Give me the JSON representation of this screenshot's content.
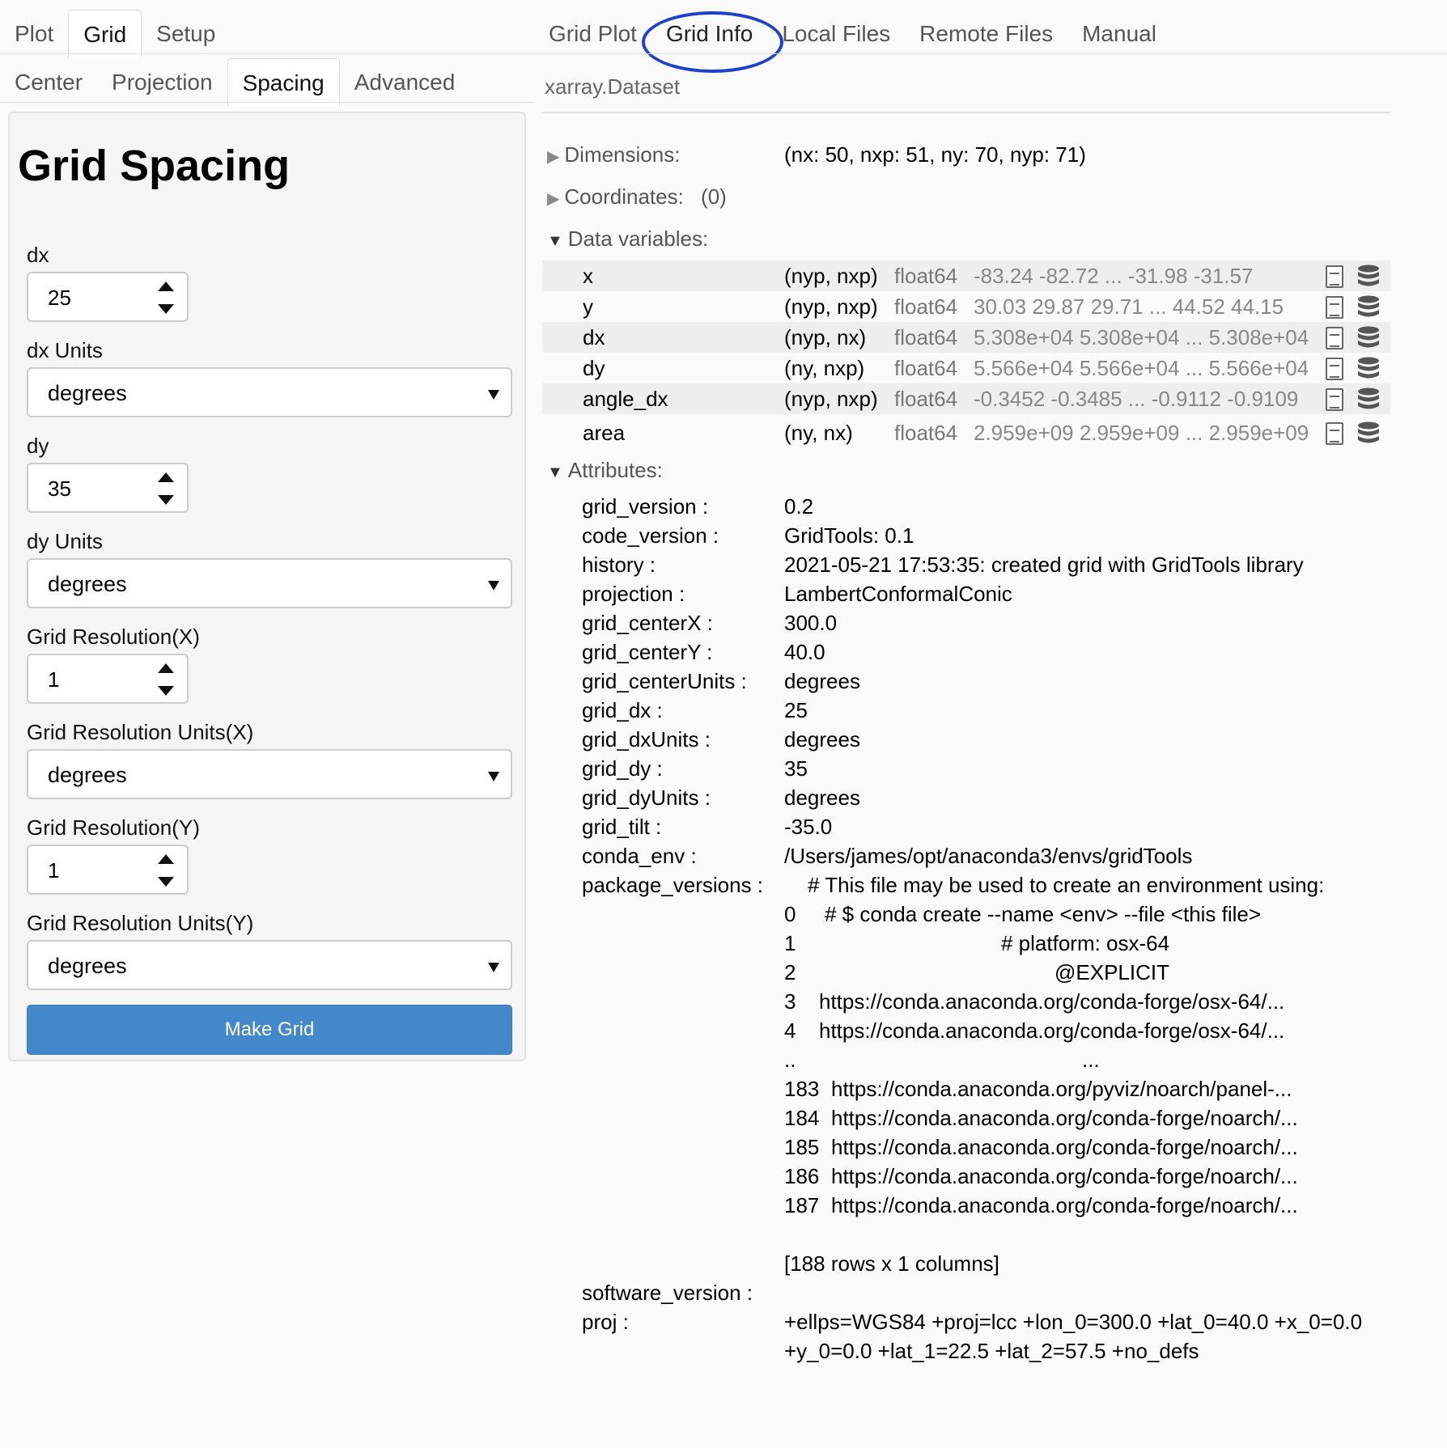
{
  "left_tabs": [
    "Plot",
    "Grid",
    "Setup"
  ],
  "left_active_tab": "Grid",
  "sub_tabs": [
    "Center",
    "Projection",
    "Spacing",
    "Advanced"
  ],
  "sub_active_tab": "Spacing",
  "right_tabs": [
    "Grid Plot",
    "Grid Info",
    "Local Files",
    "Remote Files",
    "Manual"
  ],
  "right_active_tab": "Grid Info",
  "panel": {
    "title": "Grid Spacing",
    "dx_label": "dx",
    "dx_value": "25",
    "dx_units_label": "dx Units",
    "dx_units_value": "degrees",
    "dy_label": "dy",
    "dy_value": "35",
    "dy_units_label": "dy Units",
    "dy_units_value": "degrees",
    "resx_label": "Grid Resolution(X)",
    "resx_value": "1",
    "resx_units_label": "Grid Resolution Units(X)",
    "resx_units_value": "degrees",
    "resy_label": "Grid Resolution(Y)",
    "resy_value": "1",
    "resy_units_label": "Grid Resolution Units(Y)",
    "resy_units_value": "degrees",
    "make_grid_label": "Make Grid"
  },
  "dataset": {
    "header": "xarray.Dataset",
    "dimensions_label": "Dimensions:",
    "dimensions_value": "(nx: 50, nxp: 51, ny: 70, nyp: 71)",
    "coordinates_label": "Coordinates:",
    "coordinates_value": "(0)",
    "data_vars_label": "Data variables:",
    "attributes_label": "Attributes:",
    "variables": [
      {
        "name": "x",
        "dims": "(nyp, nxp)",
        "dtype": "float64",
        "preview": "-83.24 -82.72 ... -31.98 -31.57"
      },
      {
        "name": "y",
        "dims": "(nyp, nxp)",
        "dtype": "float64",
        "preview": "30.03 29.87 29.71 ... 44.52 44.15"
      },
      {
        "name": "dx",
        "dims": "(nyp, nx)",
        "dtype": "float64",
        "preview": "5.308e+04 5.308e+04 ... 5.308e+04"
      },
      {
        "name": "dy",
        "dims": "(ny, nxp)",
        "dtype": "float64",
        "preview": "5.566e+04 5.566e+04 ... 5.566e+04"
      },
      {
        "name": "angle_dx",
        "dims": "(nyp, nxp)",
        "dtype": "float64",
        "preview": "-0.3452 -0.3485 ... -0.9112 -0.9109"
      },
      {
        "name": "area",
        "dims": "(ny, nx)",
        "dtype": "float64",
        "preview": "2.959e+09 2.959e+09 ... 2.959e+09"
      }
    ],
    "attributes": [
      {
        "key": "grid_version :",
        "value": "0.2"
      },
      {
        "key": "code_version :",
        "value": "GridTools: 0.1"
      },
      {
        "key": "history :",
        "value": "2021-05-21 17:53:35: created grid with GridTools library"
      },
      {
        "key": "projection :",
        "value": "LambertConformalConic"
      },
      {
        "key": "grid_centerX :",
        "value": "300.0"
      },
      {
        "key": "grid_centerY :",
        "value": "40.0"
      },
      {
        "key": "grid_centerUnits :",
        "value": "degrees"
      },
      {
        "key": "grid_dx :",
        "value": "25"
      },
      {
        "key": "grid_dxUnits :",
        "value": "degrees"
      },
      {
        "key": "grid_dy :",
        "value": "35"
      },
      {
        "key": "grid_dyUnits :",
        "value": "degrees"
      },
      {
        "key": "grid_tilt :",
        "value": "-35.0"
      },
      {
        "key": "conda_env :",
        "value": "/Users/james/opt/anaconda3/envs/gridTools"
      }
    ],
    "package_versions_key": "package_versions :",
    "package_versions_header": "# This file may be used to create an environment using:",
    "package_lines": [
      {
        "idx": "0",
        "text": "# $ conda create --name <env> --file <this file>"
      },
      {
        "idx": "1",
        "text": "# platform: osx-64"
      },
      {
        "idx": "2",
        "text": "@EXPLICIT"
      },
      {
        "idx": "3",
        "text": "https://conda.anaconda.org/conda-forge/osx-64/..."
      },
      {
        "idx": "4",
        "text": "https://conda.anaconda.org/conda-forge/osx-64/..."
      },
      {
        "idx": "..",
        "text": "..."
      },
      {
        "idx": "183",
        "text": "https://conda.anaconda.org/pyviz/noarch/panel-..."
      },
      {
        "idx": "184",
        "text": "https://conda.anaconda.org/conda-forge/noarch/..."
      },
      {
        "idx": "185",
        "text": "https://conda.anaconda.org/conda-forge/noarch/..."
      },
      {
        "idx": "186",
        "text": "https://conda.anaconda.org/conda-forge/noarch/..."
      },
      {
        "idx": "187",
        "text": "https://conda.anaconda.org/conda-forge/noarch/..."
      }
    ],
    "package_footer": "[188 rows x 1 columns]",
    "software_version_key": "software_version :",
    "proj_key": "proj :",
    "proj_line1": "+ellps=WGS84 +proj=lcc +lon_0=300.0 +lat_0=40.0 +x_0=0.0",
    "proj_line2": "+y_0=0.0 +lat_1=22.5 +lat_2=57.5 +no_defs"
  },
  "colors": {
    "button": "#4488cc",
    "annotation_circle": "#1d3fd6"
  },
  "icons": {
    "variable_attrs": "doc-icon",
    "variable_data": "database-icon"
  }
}
